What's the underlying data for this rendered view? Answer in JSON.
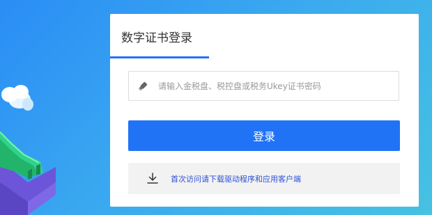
{
  "login_panel": {
    "tab_label": "数字证书登录",
    "input_placeholder": "请输入金税盘、税控盘或税务Ukey证书密码",
    "input_value": "",
    "login_button": "登录",
    "download_link": "首次访问请下载驱动程序和应用客户端"
  },
  "icons": {
    "input": "usb-key-icon",
    "download": "download-icon"
  },
  "colors": {
    "accent": "#2173f5",
    "background_start": "#2a8df5",
    "background_end": "#46c2e2",
    "link": "#2a4fd6"
  }
}
